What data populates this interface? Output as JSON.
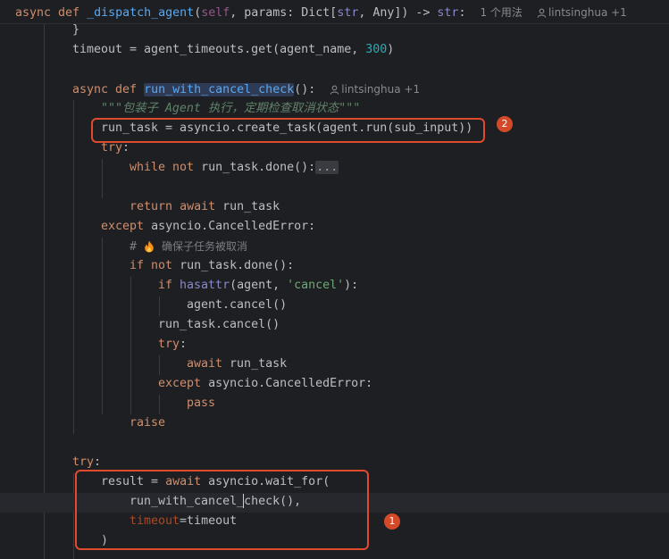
{
  "header": {
    "kw_async": "async",
    "kw_def": "def",
    "func_name": "_dispatch_agent",
    "open": "(",
    "self": "self",
    "params_text": ", params: Dict[",
    "str_type": "str",
    "sep": ", Any]) -> ",
    "ret_type": "str",
    "colon": ":",
    "usages": "1 个用法",
    "author": "lintsinghua +1"
  },
  "code": {
    "l1": "}",
    "l2_a": "timeout = agent_timeouts.get(agent_name, ",
    "l2_num": "300",
    "l2_b": ")",
    "l4_async": "async",
    "l4_def": "def",
    "l4_fn": "run_with_cancel_check",
    "l4_tail": "():",
    "l4_author": "lintsinghua +1",
    "l5_doc": "\"\"\"包装子 Agent 执行，定期检查取消状态\"\"\"",
    "l6": "run_task = asyncio.create_task(agent.run(sub_input))",
    "l7_try": "try",
    "l7_colon": ":",
    "l8_while": "while",
    "l8_not": "not",
    "l8_rest": "run_task.done():",
    "l8_fold": "...",
    "l10_return": "return",
    "l10_await": "await",
    "l10_rest": "run_task",
    "l11_except": "except",
    "l11_rest": "asyncio.CancelledError:",
    "l12_hash": "#",
    "l12_text": "确保子任务被取消",
    "l13_if": "if",
    "l13_not": "not",
    "l13_rest": "run_task.done():",
    "l14_if": "if",
    "l14_hasattr": "hasattr",
    "l14_mid": "(agent, ",
    "l14_str": "'cancel'",
    "l14_end": "):",
    "l15": "agent.cancel()",
    "l16": "run_task.cancel()",
    "l17_try": "try",
    "l17_colon": ":",
    "l18_await": "await",
    "l18_rest": "run_task",
    "l19_except": "except",
    "l19_rest": "asyncio.CancelledError:",
    "l20": "pass",
    "l21": "raise",
    "l23_try": "try",
    "l23_colon": ":",
    "l24_a": "result = ",
    "l24_await": "await",
    "l24_b": "asyncio.wait_for(",
    "l25_a": "run_with_cancel_",
    "l25_b": "check",
    "l25_c": "(),",
    "l26_param": "timeout",
    "l26_rest": "=timeout",
    "l27": ")"
  },
  "annotations": {
    "badge_1": "1",
    "badge_2": "2"
  },
  "colors": {
    "background": "#1e1f22",
    "keyword": "#cf8e6d",
    "function": "#56a8f5",
    "number": "#2aacb8",
    "string": "#6aab73",
    "annotation_red": "#e04b2d"
  }
}
